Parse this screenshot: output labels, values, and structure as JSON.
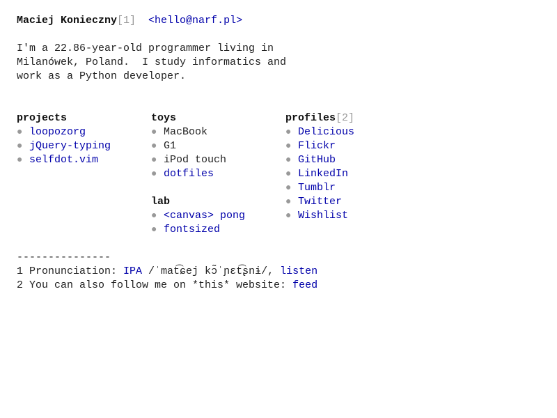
{
  "header": {
    "name": "Maciej Konieczny",
    "footnote_ref_1": "[1]",
    "email_link": "<hello@narf.pl>"
  },
  "bio": {
    "line1": "I'm a 22.86-year-old programmer living in",
    "line2": "Milanówek, Poland.  I study informatics and",
    "line3": "work as a Python developer."
  },
  "projects": {
    "heading": "projects",
    "items": [
      "loopozorg",
      "jQuery-typing",
      "selfdot.vim"
    ]
  },
  "toys": {
    "heading": "toys",
    "items": [
      "MacBook",
      "G1",
      "iPod touch"
    ],
    "links": [
      "dotfiles"
    ]
  },
  "lab": {
    "heading": "lab",
    "items": [
      "<canvas> pong",
      "fontsized"
    ]
  },
  "profiles": {
    "heading": "profiles",
    "footnote_ref_2": "[2]",
    "items": [
      "Delicious",
      "Flickr",
      "GitHub",
      "LinkedIn",
      "Tumblr",
      "Twitter",
      "Wishlist"
    ]
  },
  "footnotes": {
    "rule": "---------------",
    "note1_prefix": "1 Pronunciation: ",
    "note1_ipa_link": "IPA",
    "note1_ipa_text": " /ˈmat͡ɕej kɔ̃ˈɲɛt͡ʂnɨ/, ",
    "note1_listen_link": "listen",
    "note2_prefix": "2 You can also follow me on *this* website: ",
    "note2_feed_link": "feed"
  },
  "colors": {
    "link": "#0000aa",
    "text": "#222222",
    "muted": "#999999"
  },
  "icons": {
    "bullet": "bullet-icon"
  }
}
